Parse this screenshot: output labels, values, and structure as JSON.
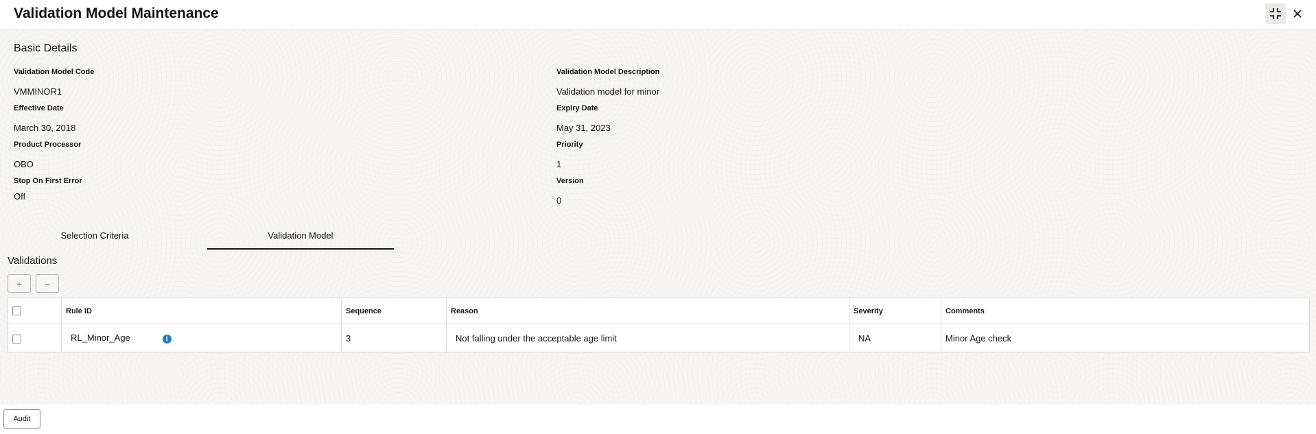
{
  "header": {
    "title": "Validation Model Maintenance",
    "minimize_icon": "collapse-icon",
    "close_icon": "close-icon"
  },
  "basic_details": {
    "section_title": "Basic Details",
    "fields": {
      "validation_model_code": {
        "label": "Validation Model Code",
        "value": "VMMINOR1"
      },
      "validation_model_description": {
        "label": "Validation Model Description",
        "value": "Validation model for minor"
      },
      "effective_date": {
        "label": "Effective Date",
        "value": "March 30, 2018"
      },
      "expiry_date": {
        "label": "Expiry Date",
        "value": "May 31, 2023"
      },
      "product_processor": {
        "label": "Product Processor",
        "value": "OBO"
      },
      "priority": {
        "label": "Priority",
        "value": "1"
      },
      "stop_on_first_error": {
        "label": "Stop On First Error",
        "value": "Off"
      },
      "version": {
        "label": "Version",
        "value": "0"
      }
    }
  },
  "tabs": [
    {
      "label": "Selection Criteria",
      "active": false
    },
    {
      "label": "Validation Model",
      "active": true
    }
  ],
  "validations": {
    "title": "Validations",
    "add_label": "+",
    "remove_label": "−",
    "columns": [
      "Rule ID",
      "Sequence",
      "Reason",
      "Severity",
      "Comments"
    ],
    "rows": [
      {
        "rule_id": "RL_Minor_Age",
        "sequence": "3",
        "reason": "Not falling under the acceptable age limit",
        "severity": "NA",
        "comments": "Minor Age check"
      }
    ]
  },
  "footer": {
    "audit_label": "Audit"
  },
  "colors": {
    "accent_info": "#227abd",
    "text": "#161513"
  }
}
